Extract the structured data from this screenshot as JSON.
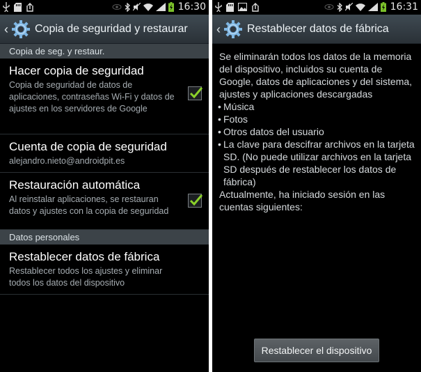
{
  "status_bar": {
    "left_time": "16:30",
    "right_time": "16:31",
    "icons": [
      "usb-icon",
      "sd-card-icon",
      "image-icon",
      "upload-icon",
      "eye-icon",
      "bluetooth-icon",
      "mute-icon",
      "wifi-icon",
      "signal-icon",
      "battery-charging-icon"
    ]
  },
  "left_screen": {
    "title": "Copia de seguridad y restaurar",
    "section_backup": "Copia de seg. y restaur.",
    "items": [
      {
        "title": "Hacer copia de seguridad",
        "summary": "Copia de seguridad de datos de aplicaciones, contraseñas Wi-Fi y datos de ajustes en los servidores de Google",
        "checked": true
      },
      {
        "title": "Cuenta de copia de seguridad",
        "summary": "alejandro.nieto@androidpit.es"
      },
      {
        "title": "Restauración automática",
        "summary": "Al reinstalar aplicaciones, se restauran datos y ajustes con la copia de seguridad",
        "checked": true
      }
    ],
    "section_personal": "Datos personales",
    "factory_item": {
      "title": "Restablecer datos de fábrica",
      "summary": "Restablecer todos los ajustes y eliminar todos los datos del dispositivo"
    }
  },
  "right_screen": {
    "title": "Restablecer datos de fábrica",
    "intro": "Se eliminarán todos los datos de la memoria del dispositivo, incluidos su cuenta de Google, datos de aplicaciones y del sistema, ajustes y aplicaciones descargadas",
    "bullets": [
      "Música",
      "Fotos",
      "Otros datos del usuario",
      "La clave para descifrar archivos en la tarjeta SD. (No puede utilizar archivos en la tarjeta SD después de restablecer los datos de fábrica)"
    ],
    "accounts_text": "Actualmente, ha iniciado sesión en las cuentas siguientes:",
    "reset_button": "Restablecer el dispositivo"
  },
  "colors": {
    "action_bar": "#3f4a52",
    "section_header": "#3c4348",
    "check_green": "#8bd12a",
    "gear_blue": "#7fb7e4"
  }
}
